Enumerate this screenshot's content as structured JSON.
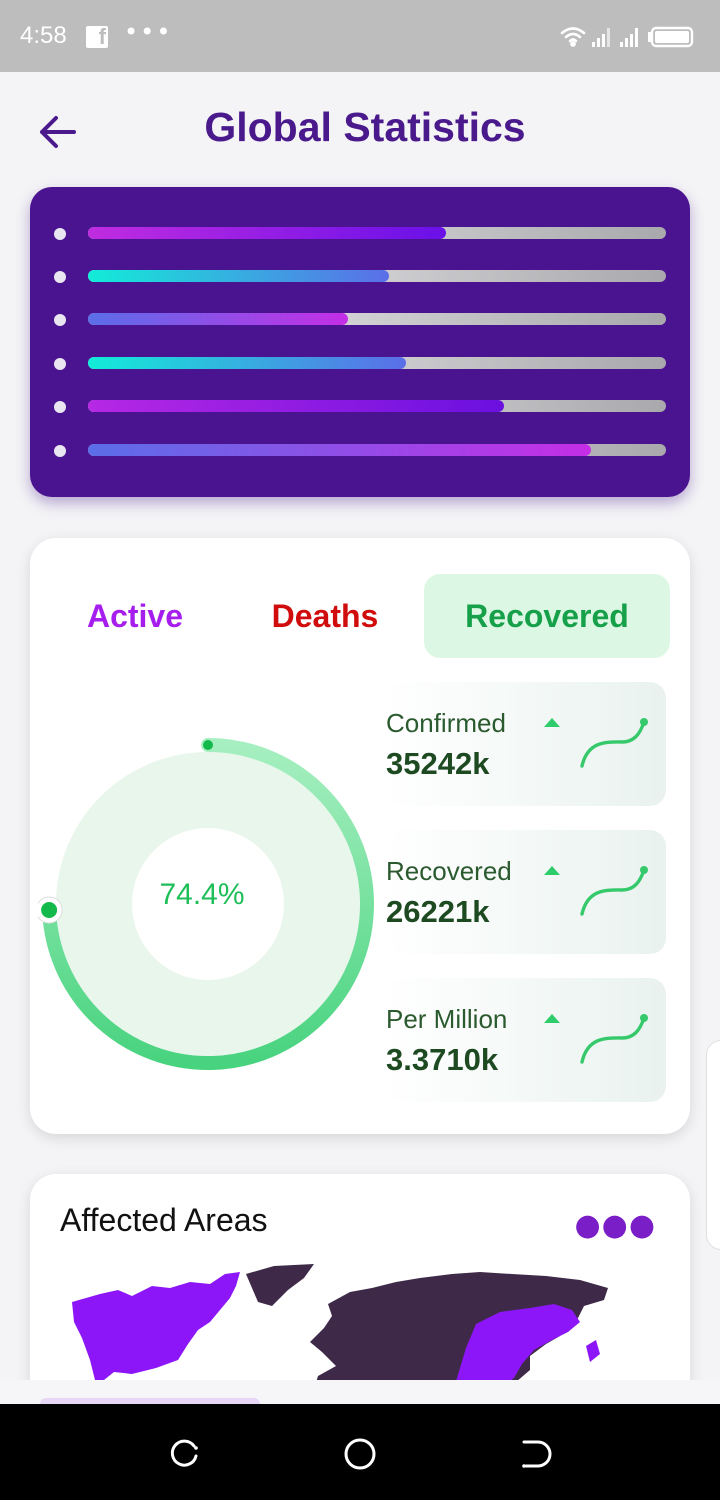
{
  "status_bar": {
    "time": "4:58",
    "icons": [
      "facebook-icon",
      "more-dots-icon",
      "wifi-icon",
      "signal-icon",
      "signal-icon",
      "battery-icon"
    ]
  },
  "header": {
    "title": "Global Statistics",
    "back_icon": "arrow-left-icon"
  },
  "bars_card": {
    "bars": [
      {
        "fill": 0.62,
        "from": "#c02ce0",
        "to": "#6a10e8"
      },
      {
        "fill": 0.52,
        "from": "#12ecd8",
        "to": "#5b6ee8"
      },
      {
        "fill": 0.45,
        "from": "#5b6ee8",
        "to": "#c52ee6"
      },
      {
        "fill": 0.55,
        "from": "#12ecd8",
        "to": "#5b6ee8"
      },
      {
        "fill": 0.72,
        "from": "#b628e4",
        "to": "#6b10e0"
      },
      {
        "fill": 0.87,
        "from": "#5b6ee8",
        "to": "#c52ee6"
      }
    ]
  },
  "tabs": {
    "active": "Active",
    "deaths": "Deaths",
    "recovered": "Recovered",
    "selected": "Recovered"
  },
  "stats": [
    {
      "label": "Confirmed",
      "value": "35242k"
    },
    {
      "label": "Recovered",
      "value": "26221k"
    },
    {
      "label": "Per Million",
      "value": "3.3710k"
    }
  ],
  "donut": {
    "percent_label": "74.4%",
    "percent": 74.4,
    "color": "#37d07a"
  },
  "areas": {
    "title": "Affected Areas",
    "menu_icon": "more-horizontal-icon"
  },
  "nav": {
    "icons": [
      "recent-apps-icon",
      "home-icon",
      "back-icon"
    ]
  }
}
